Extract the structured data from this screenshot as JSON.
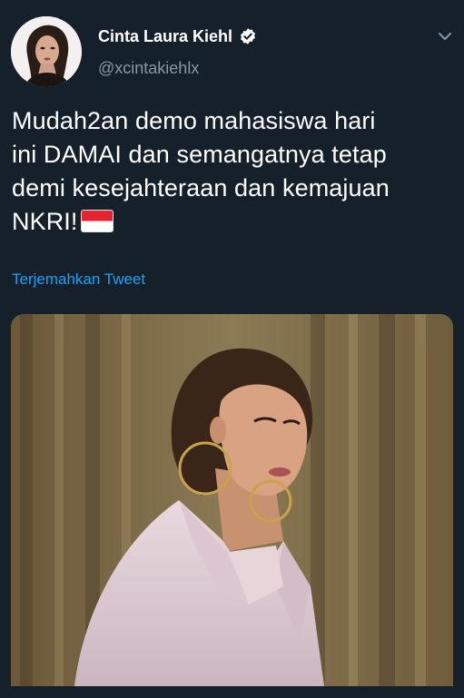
{
  "tweet": {
    "author": {
      "display_name": "Cinta Laura Kiehl",
      "handle": "@xcintakiehlx",
      "verified": true,
      "avatar_icon": "profile-photo"
    },
    "text_lines": [
      "Mudah2an demo mahasiswa hari",
      "ini DAMAI dan semangatnya tetap",
      "demi kesejahteraan dan kemajuan",
      "NKRI!"
    ],
    "flag_emoji": "indonesia-flag",
    "translate_label": "Terjemahkan Tweet",
    "menu_icon": "chevron-down-icon",
    "media_alt": "photo"
  },
  "colors": {
    "background": "#15202b",
    "primary_text": "#ffffff",
    "secondary_text": "#8899a6",
    "link": "#1da1f2"
  }
}
